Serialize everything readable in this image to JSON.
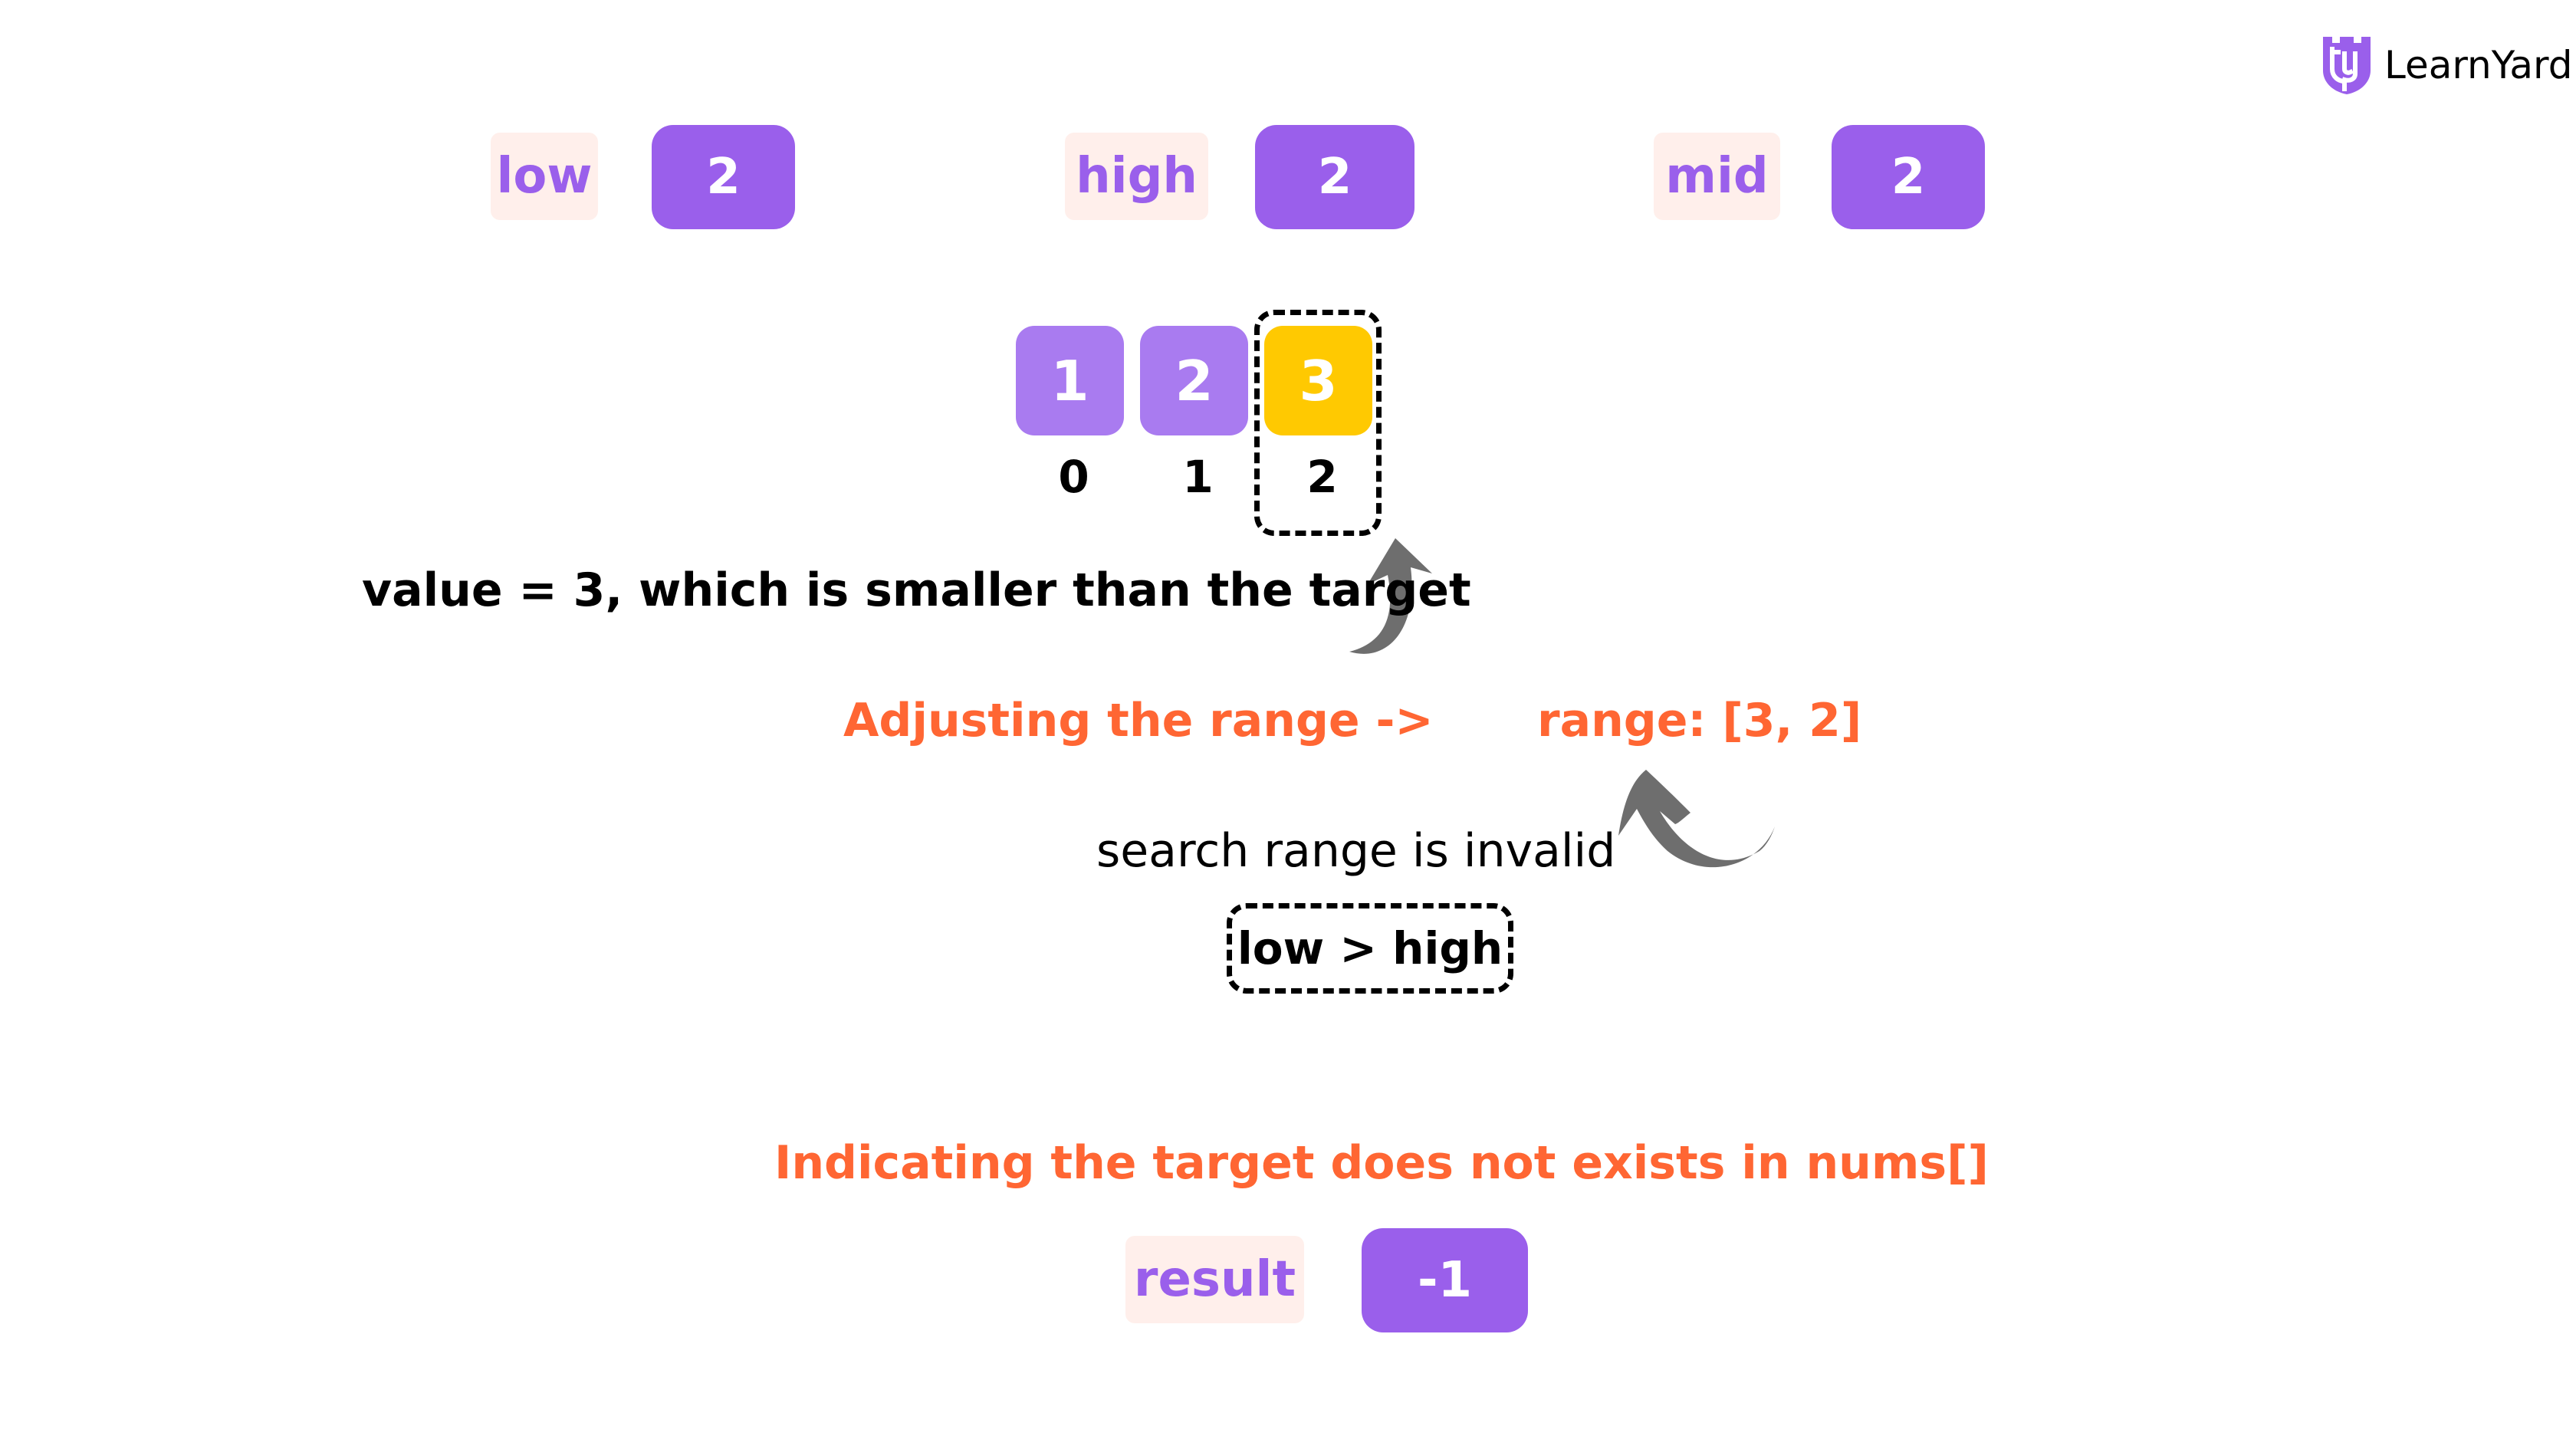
{
  "brand": {
    "name": "LearnYard",
    "logo_icon": "shield-y-icon",
    "accent": "#9A5FEB"
  },
  "pointers": [
    {
      "label": "low",
      "value": "2"
    },
    {
      "label": "high",
      "value": "2"
    },
    {
      "label": "mid",
      "value": "2"
    }
  ],
  "array": {
    "cells": [
      {
        "value": "1",
        "index": "0",
        "highlight": false
      },
      {
        "value": "2",
        "index": "1",
        "highlight": false
      },
      {
        "value": "3",
        "index": "2",
        "highlight": true
      }
    ]
  },
  "annotations": {
    "comparison": "value = 3, which is smaller than the target",
    "adjusting": "Adjusting the range ->",
    "range": "range: [3, 2]",
    "invalid": "search range is invalid",
    "condition": "low > high",
    "conclusion": "Indicating the target does not exists in nums[]"
  },
  "result": {
    "label": "result",
    "value": "-1"
  },
  "colors": {
    "label_bg": "#FFEFEB",
    "value_bg": "#9A5FEB",
    "cell_purple": "#A97BF0",
    "cell_highlight": "#FFC901",
    "annotation_orange": "#FF6633",
    "arrow_gray": "#6E6E6E"
  }
}
